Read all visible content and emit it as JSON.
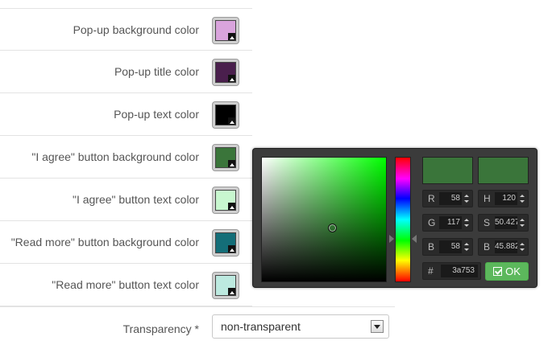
{
  "settings": [
    {
      "label": "Pop-up background color",
      "color": "#d9a4dc"
    },
    {
      "label": "Pop-up title color",
      "color": "#4a1f4d"
    },
    {
      "label": "Pop-up text color",
      "color": "#000000"
    },
    {
      "label": "\"I agree\" button background color",
      "color": "#3a753a"
    },
    {
      "label": "\"I agree\" button text color",
      "color": "#c8f7cf"
    },
    {
      "label": "\"Read more\" button background color",
      "color": "#146e78"
    },
    {
      "label": "\"Read more\" button text color",
      "color": "#bdeae0"
    }
  ],
  "transparency": {
    "label": "Transparency *",
    "selected": "non-transparent"
  },
  "color_picker": {
    "new_color": "#3a753a",
    "old_color": "#3a753a",
    "fields": {
      "r": {
        "label": "R",
        "value": "58"
      },
      "g": {
        "label": "G",
        "value": "117"
      },
      "b": {
        "label": "B",
        "value": "58"
      },
      "h": {
        "label": "H",
        "value": "120"
      },
      "s": {
        "label": "S",
        "value": "50.427"
      },
      "br": {
        "label": "B",
        "value": "45.882"
      }
    },
    "hex": {
      "label": "#",
      "value": "3a753"
    },
    "ok_label": "OK"
  }
}
